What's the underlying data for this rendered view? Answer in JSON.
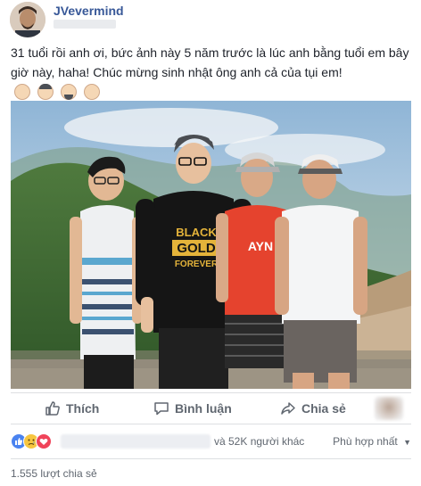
{
  "post": {
    "author": "JVevermind",
    "caption": "31 tuổi rồi anh ơi, bức ảnh này 5 năm trước là lúc anh bằng tuổi em bây giờ này, haha! Chúc mừng sinh nhật ông anh cả của tụi em!",
    "caption_emojis": [
      "man-emoji",
      "man-hat-emoji",
      "man-beard-emoji",
      "man-emoji"
    ]
  },
  "photo": {
    "shirt_text_line1": "BLACK",
    "shirt_text_line2": "GOLD",
    "shirt_text_line3": "FOREVER",
    "red_shirt_text": "AYN"
  },
  "actions": {
    "like_label": "Thích",
    "comment_label": "Bình luận",
    "share_label": "Chia sẻ"
  },
  "reactions": {
    "icons": [
      "like-reaction-icon",
      "sad-reaction-icon",
      "love-reaction-icon"
    ],
    "count_text": "và 52K người khác",
    "sort_label": "Phù hợp nhất"
  },
  "shares": {
    "text": "1.555 lượt chia sẻ"
  },
  "colors": {
    "author_link": "#385898",
    "like_blue": "#4a83f0",
    "love_red": "#f0445a",
    "sad_yellow": "#f7c640",
    "secondary_text": "#606770"
  }
}
